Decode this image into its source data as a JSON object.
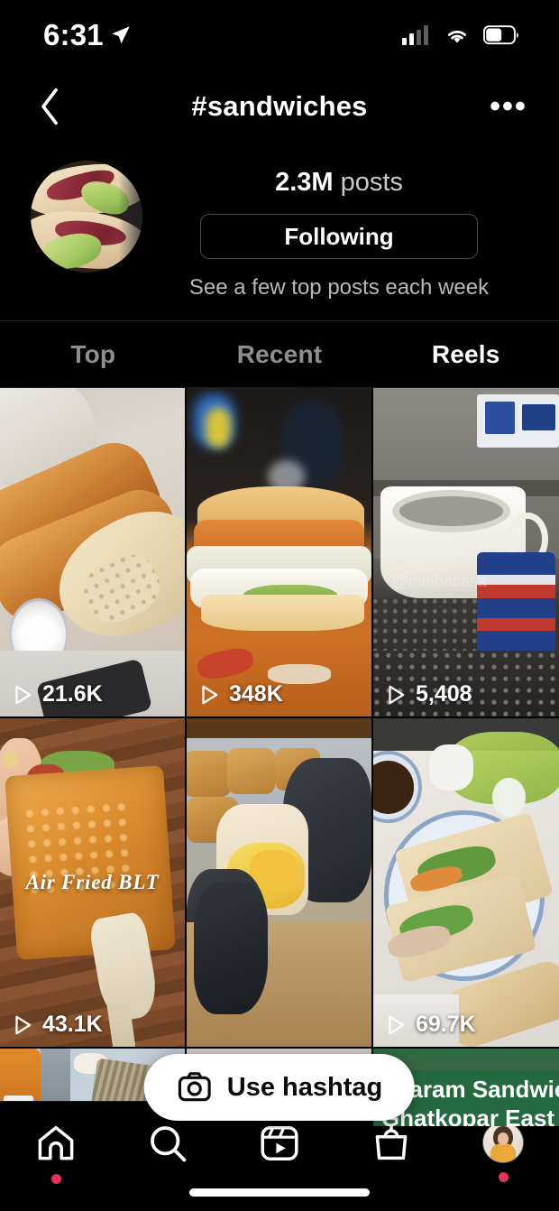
{
  "status_bar": {
    "time": "6:31",
    "location_icon": "location-arrow-icon",
    "cellular_icon": "cellular-signal-icon",
    "cellular_bars_filled": 2,
    "cellular_bars_total": 4,
    "wifi_icon": "wifi-icon",
    "battery_icon": "battery-icon",
    "battery_level_percent": 58
  },
  "header": {
    "back_icon": "chevron-left-icon",
    "title": "#sandwiches",
    "more_icon": "more-options-icon",
    "more_label": "•••"
  },
  "profile": {
    "avatar_icon": "hashtag-avatar-sandwich",
    "posts_count": "2.3M",
    "posts_word": "posts",
    "follow_button_label": "Following",
    "subtitle": "See a few top posts each week"
  },
  "tabs": [
    {
      "label": "Top",
      "active": false
    },
    {
      "label": "Recent",
      "active": false
    },
    {
      "label": "Reels",
      "active": true
    }
  ],
  "grid": {
    "play_icon": "play-triangle-icon",
    "tiles": [
      {
        "id": "tile-baguettes",
        "description": "Baguettes on wooden board with bowl of salt",
        "plays": "21.6K",
        "overlay_text": "",
        "watermark": ""
      },
      {
        "id": "tile-torta",
        "description": "Cross-section torta sandwich on orange cutting board",
        "plays": "348K",
        "overlay_text": "",
        "watermark": ""
      },
      {
        "id": "tile-tuna-cans",
        "description": "White bowl with stacked Bumble Bee Albacore tuna cans on granite counter",
        "plays": "5,408",
        "overlay_text": "",
        "watermark": "@minhacasa"
      },
      {
        "id": "tile-air-fried-blt",
        "description": "Toasted BLT sandwich held on spatula over wooden table",
        "plays": "43.1K",
        "overlay_text": "Air Fried BLT",
        "watermark": ""
      },
      {
        "id": "tile-egg-slider",
        "description": "Gloved hands holding cheesy egg slider with sesame buns",
        "plays": "",
        "overlay_text": "",
        "watermark": ""
      },
      {
        "id": "tile-banh-mi",
        "description": "Banh mi sandwiches on blue and white plate with herbs and dipping sauce",
        "plays": "69.7K",
        "overlay_text": "",
        "watermark": ""
      }
    ],
    "partial_tiles": [
      {
        "id": "tile-drink-grater",
        "description": "Orange drink bottle and cheese grater on light blue surface",
        "banner_line1": "",
        "banner_line2": ""
      },
      {
        "id": "tile-person",
        "description": "Top of a person's head with dark hair",
        "banner_line1": "",
        "banner_line2": ""
      },
      {
        "id": "tile-balaram-sandwich",
        "description": "Street food sandwich clip with green location banner",
        "banner_line1": "Balaram Sandwich",
        "banner_line2": "Ghatkopar East"
      }
    ]
  },
  "hashtag_button": {
    "icon": "camera-icon",
    "label": "Use hashtag"
  },
  "bottom_nav": {
    "items": [
      {
        "id": "nav-home",
        "icon": "home-icon",
        "badge": true
      },
      {
        "id": "nav-search",
        "icon": "search-icon",
        "badge": false
      },
      {
        "id": "nav-reels",
        "icon": "reels-icon",
        "badge": false
      },
      {
        "id": "nav-shop",
        "icon": "shop-bag-icon",
        "badge": false
      },
      {
        "id": "nav-profile",
        "icon": "profile-avatar-icon",
        "badge": true
      }
    ],
    "home_indicator": "home-indicator-bar"
  },
  "colors": {
    "background": "#000000",
    "text_primary": "#ffffff",
    "text_secondary": "#8e8e8e",
    "badge_red": "#ed2f5b",
    "banner_green": "#24693f",
    "pill_white": "#ffffff"
  }
}
